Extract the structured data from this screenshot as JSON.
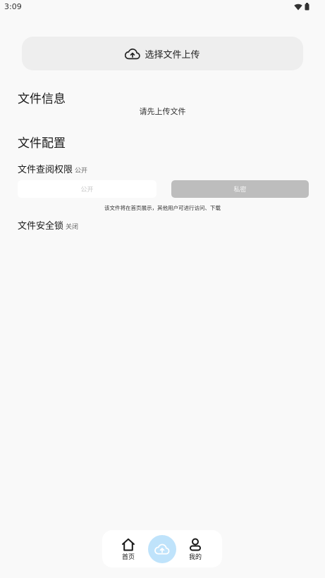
{
  "status_bar": {
    "time": "3:09"
  },
  "upload": {
    "button_label": "选择文件上传",
    "icon": "cloud-upload-icon"
  },
  "file_info": {
    "title": "文件信息",
    "hint": "请先上传文件"
  },
  "file_config": {
    "title": "文件配置",
    "permission": {
      "label": "文件查阅权限",
      "value": "公开",
      "options": [
        "公开",
        "私密"
      ],
      "note": "该文件将在首页展示，其他用户可进行访问、下载"
    },
    "security_lock": {
      "label": "文件安全锁",
      "value": "关闭"
    }
  },
  "bottom_nav": {
    "home_label": "首页",
    "mine_label": "我的",
    "icons": [
      "home-icon",
      "cloud-upload-icon",
      "user-icon"
    ],
    "upload_accent": "#bfe3fb"
  }
}
